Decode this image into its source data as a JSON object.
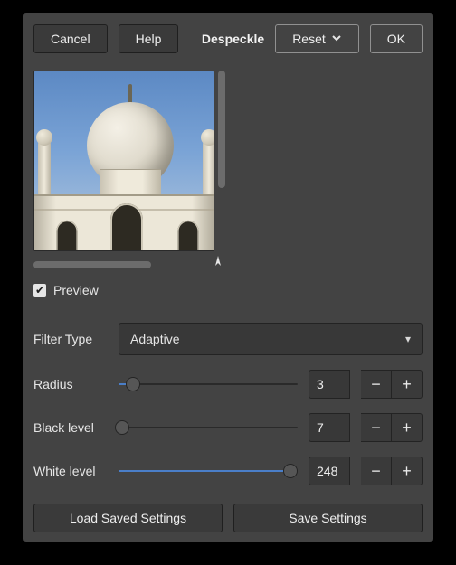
{
  "toolbar": {
    "cancel": "Cancel",
    "help": "Help",
    "title": "Despeckle",
    "reset": "Reset",
    "ok": "OK"
  },
  "preview": {
    "checkbox_label": "Preview",
    "checked": true
  },
  "form": {
    "filter_type": {
      "label": "Filter Type",
      "value": "Adaptive"
    },
    "radius": {
      "label": "Radius",
      "value": "3",
      "min": 1,
      "max": 20,
      "pct": 8
    },
    "black_level": {
      "label": "Black level",
      "value": "7",
      "min": -1,
      "max": 255,
      "pct": 2
    },
    "white_level": {
      "label": "White level",
      "value": "248",
      "min": 0,
      "max": 256,
      "pct": 96
    }
  },
  "footer": {
    "load": "Load Saved Settings",
    "save": "Save Settings"
  }
}
